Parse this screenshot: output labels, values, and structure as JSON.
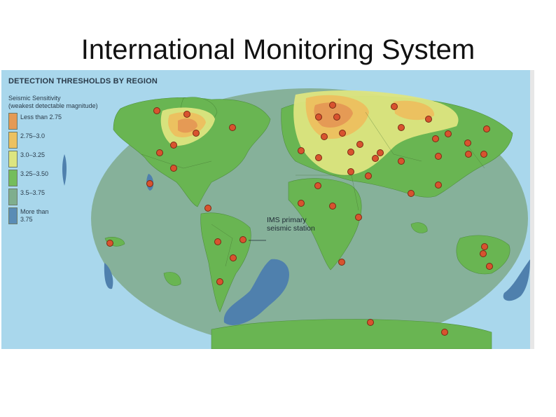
{
  "slide": {
    "title": "International Monitoring System"
  },
  "map": {
    "heading": "DETECTION THRESHOLDS BY REGION",
    "legend": {
      "title": "Seismic Sensitivity",
      "subtitle": "(weakest detectable magnitude)",
      "items": [
        {
          "label": "Less than 2.75",
          "color": "#e59a55"
        },
        {
          "label": "2.75–3.0",
          "color": "#ecc160"
        },
        {
          "label": "3.0–3.25",
          "color": "#dde57f"
        },
        {
          "label": "3.25–3.50",
          "color": "#74bd5c"
        },
        {
          "label": "3.5–3.75",
          "color": "#7fae8e"
        },
        {
          "label": "More than 3.75",
          "color": "#5a8cb5"
        }
      ]
    },
    "callout": {
      "line1": "IMS primary",
      "line2": "seismic station"
    },
    "colors": {
      "ocean": "#a9d7ec",
      "globe_ocean": "#86b19a",
      "land_green": "#69b552",
      "deep_blue": "#4f80ad",
      "station_fill": "#d8532f",
      "station_stroke": "#7a2a14"
    }
  }
}
